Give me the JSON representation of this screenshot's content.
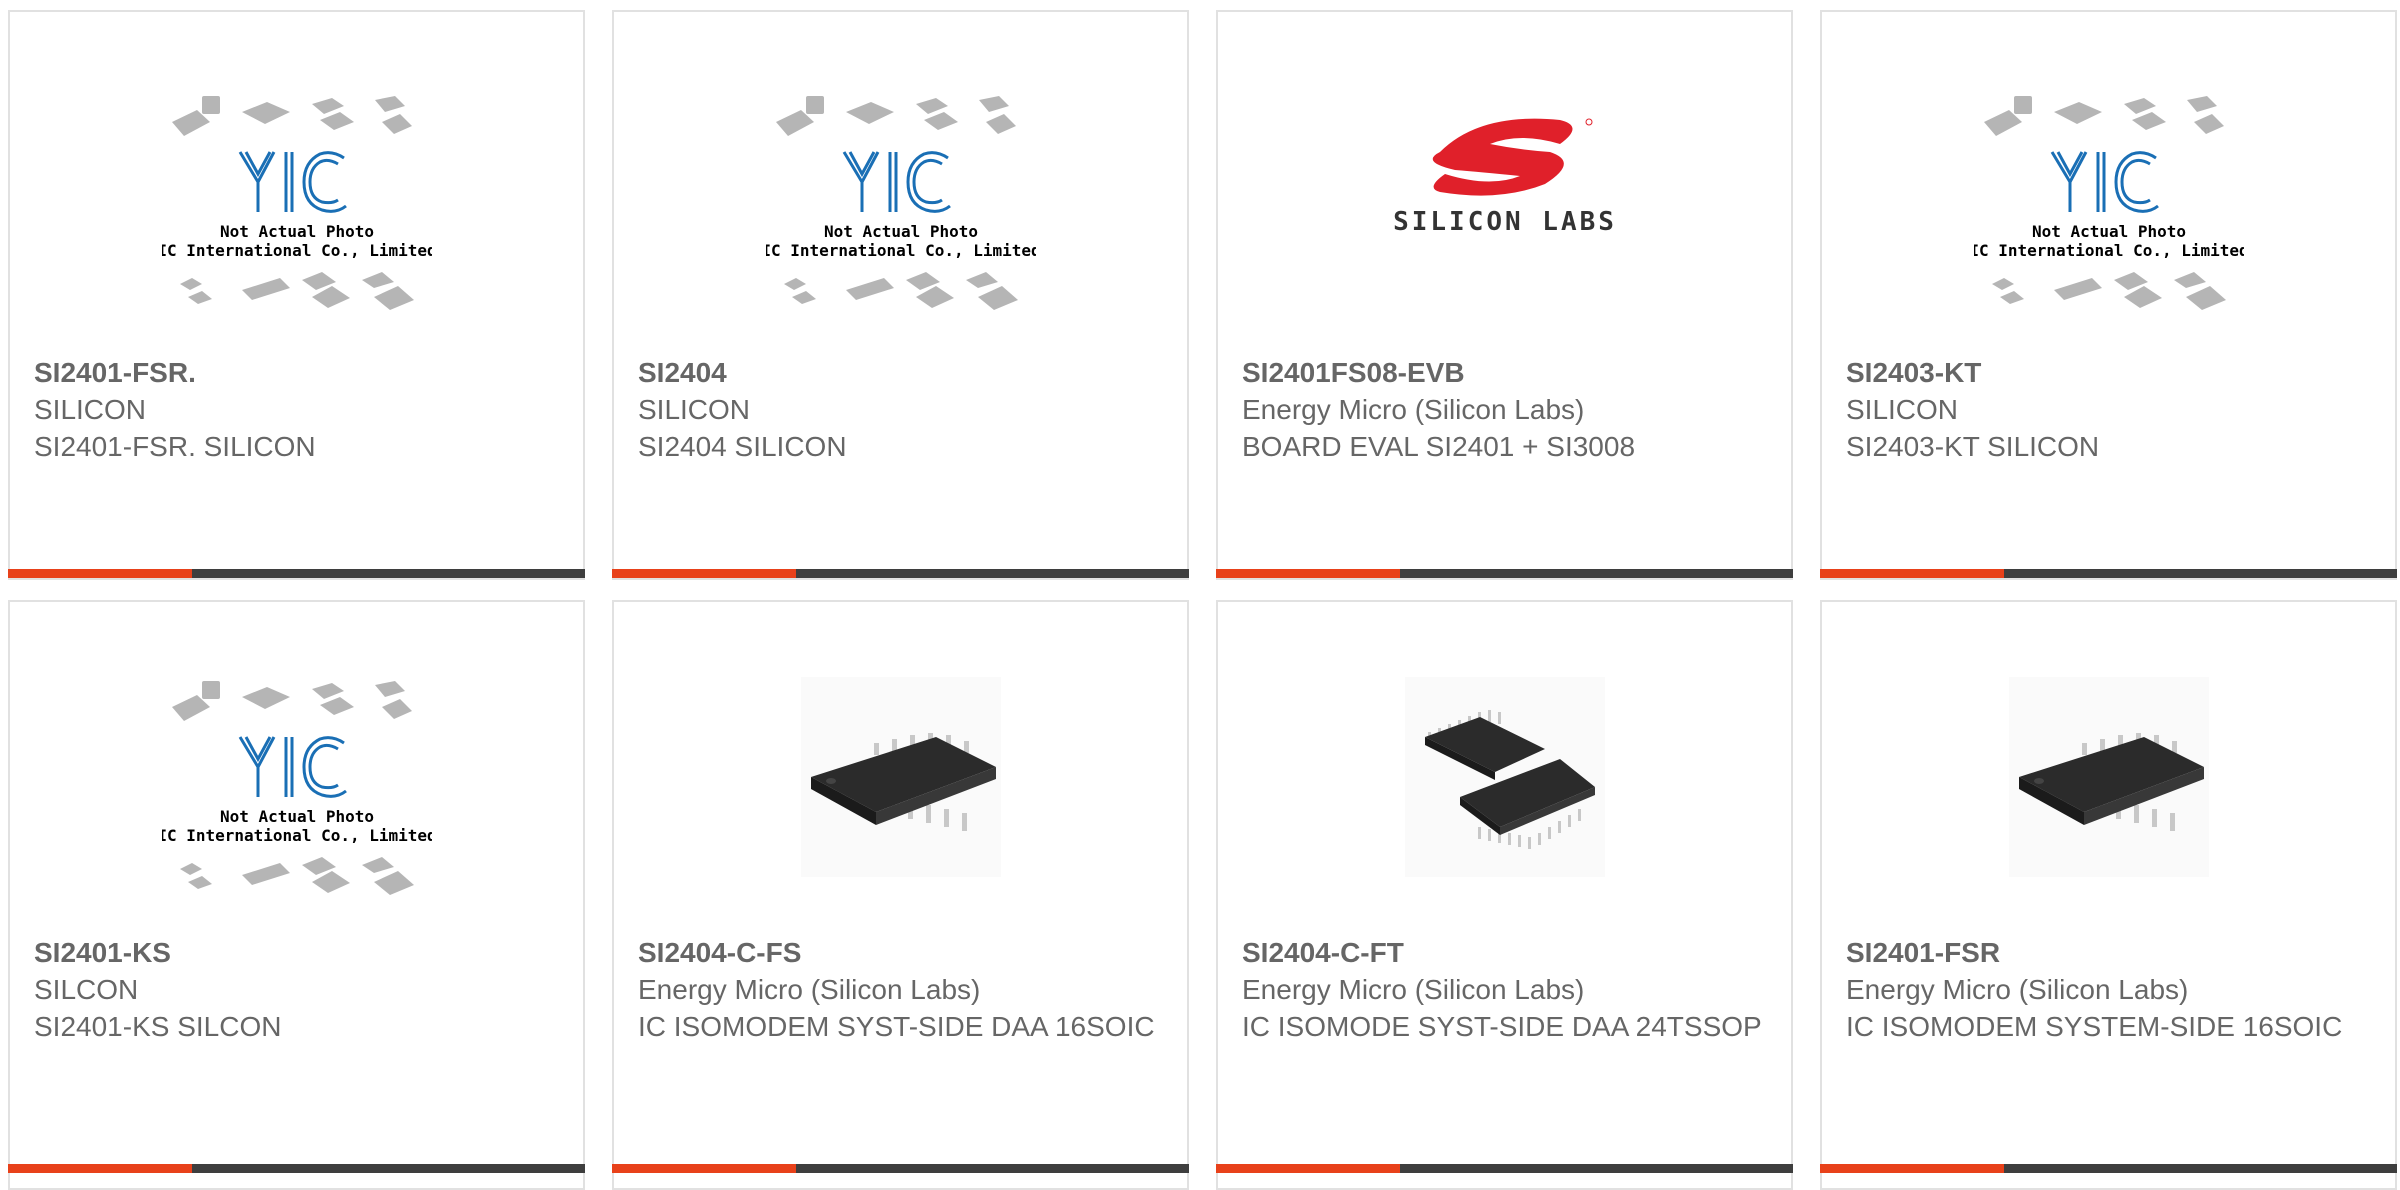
{
  "products": [
    {
      "part": "SI2401-FSR.",
      "manufacturer": "SILICON",
      "description": "SI2401-FSR. SILICON",
      "image": "yic-placeholder"
    },
    {
      "part": "SI2404",
      "manufacturer": "SILICON",
      "description": "SI2404 SILICON",
      "image": "yic-placeholder"
    },
    {
      "part": "SI2401FS08-EVB",
      "manufacturer": "Energy Micro (Silicon Labs)",
      "description": "BOARD EVAL SI2401 + SI3008",
      "image": "silicon-labs-logo"
    },
    {
      "part": "SI2403-KT",
      "manufacturer": "SILICON",
      "description": "SI2403-KT SILICON",
      "image": "yic-placeholder"
    },
    {
      "part": "SI2401-KS",
      "manufacturer": "SILCON",
      "description": "SI2401-KS SILCON",
      "image": "yic-placeholder"
    },
    {
      "part": "SI2404-C-FS",
      "manufacturer": "Energy Micro (Silicon Labs)",
      "description": "IC ISOMODEM SYST-SIDE DAA 16SOIC",
      "image": "soic-chip"
    },
    {
      "part": "SI2404-C-FT",
      "manufacturer": "Energy Micro (Silicon Labs)",
      "description": "IC ISOMODE SYST-SIDE DAA 24TSSOP",
      "image": "tssop-chips"
    },
    {
      "part": "SI2401-FSR",
      "manufacturer": "Energy Micro (Silicon Labs)",
      "description": "IC ISOMODEM SYSTEM-SIDE 16SOIC",
      "image": "soic-chip"
    }
  ],
  "placeholder": {
    "brand": "YIC",
    "line1": "Not Actual Photo",
    "line2": "YIC International Co., Limited."
  },
  "logo_text": "SILICON LABS",
  "colors": {
    "accent": "#e8411a",
    "bar": "#3e3e3e",
    "text": "#666666",
    "border": "#e1e1e1",
    "yic_blue": "#1a6fb5",
    "silabs_red": "#e0202a"
  }
}
